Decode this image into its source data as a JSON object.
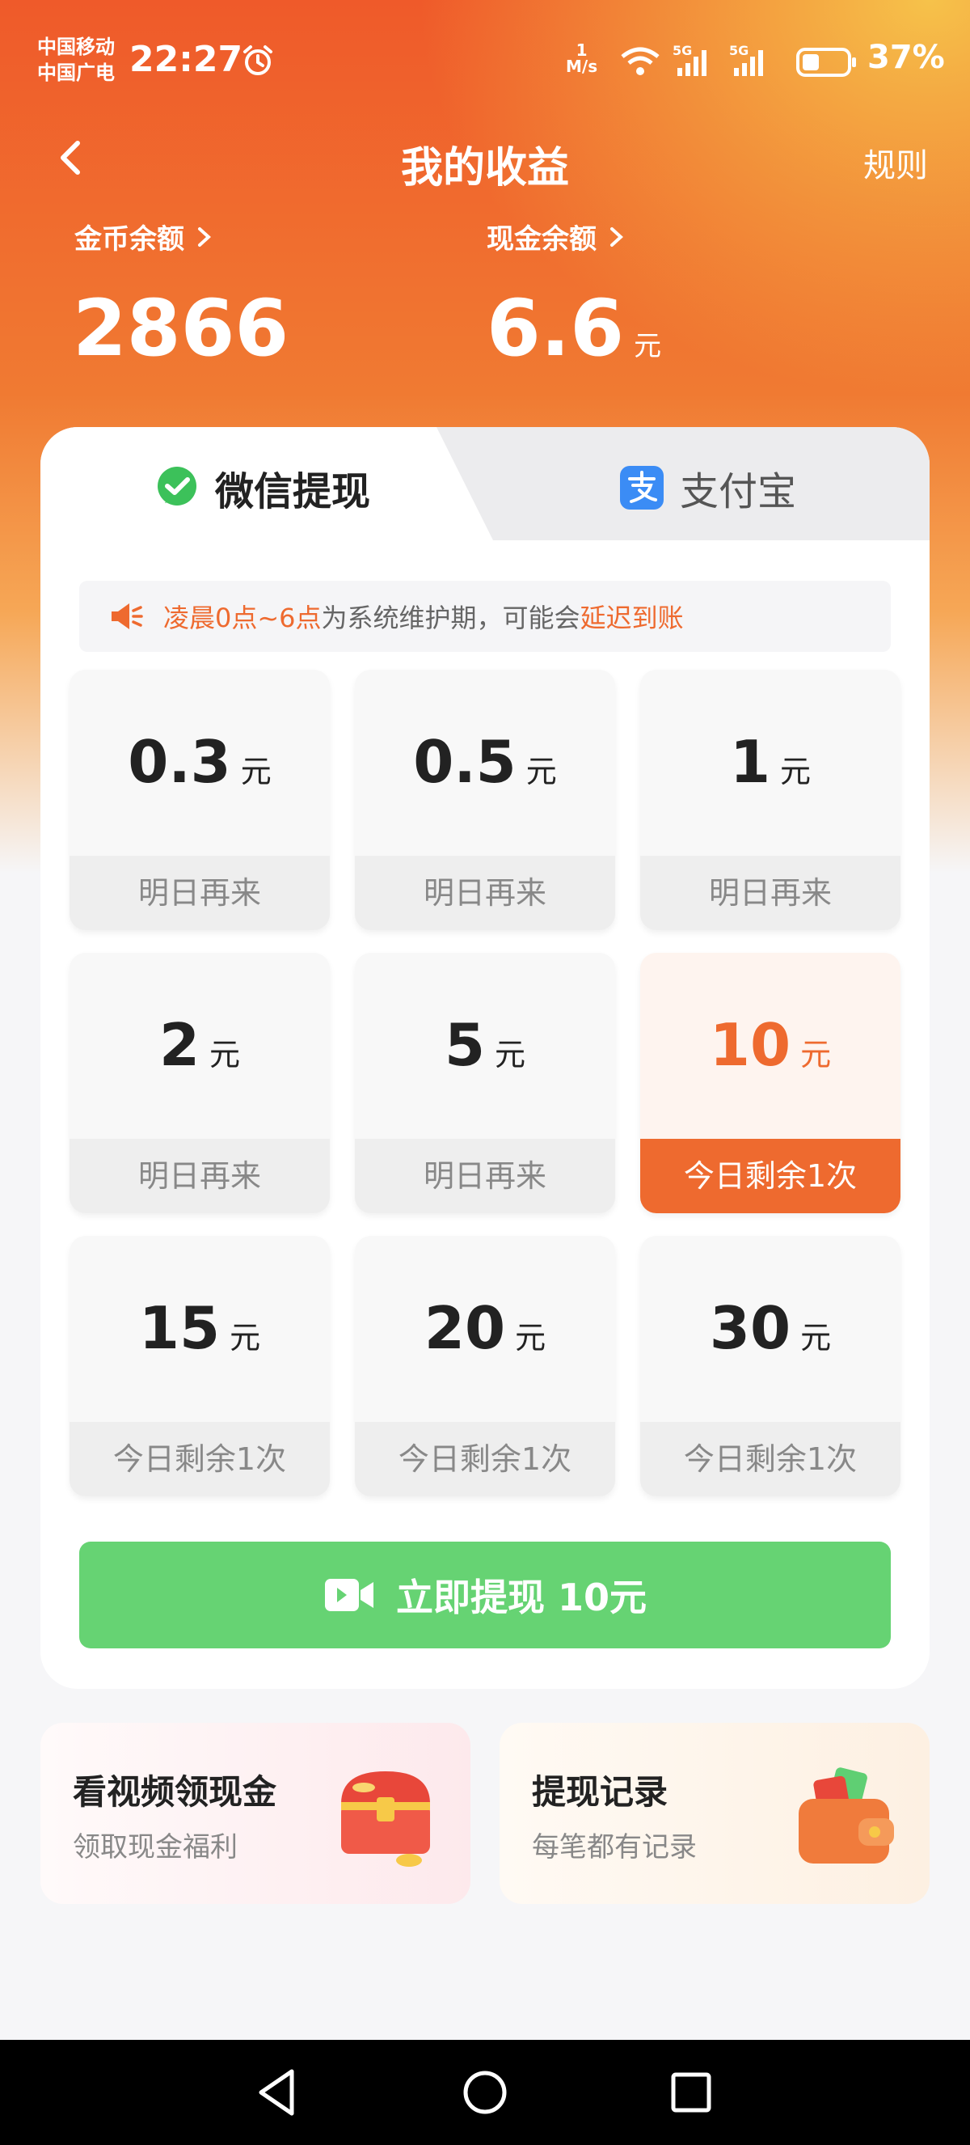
{
  "status_bar": {
    "carrier_1": "中国移动",
    "carrier_2": "中国广电",
    "time": "22:27",
    "net_speed_value": "1",
    "net_speed_unit": "M/s",
    "battery": "37%"
  },
  "header": {
    "title": "我的收益",
    "rules": "规则"
  },
  "balances": {
    "coin_label": "金币余额",
    "coin_value": "2866",
    "cash_label": "现金余额",
    "cash_value": "6.6",
    "cash_unit": "元"
  },
  "tabs": [
    {
      "label": "微信提现",
      "active": true
    },
    {
      "label": "支付宝",
      "active": false
    }
  ],
  "notice": {
    "part1": "凌晨0点~6点",
    "part2": "为系统维护期，可能会",
    "part3": "延迟到账"
  },
  "amounts": [
    {
      "value": "0.3",
      "unit": "元",
      "status": "明日再来",
      "selected": false
    },
    {
      "value": "0.5",
      "unit": "元",
      "status": "明日再来",
      "selected": false
    },
    {
      "value": "1",
      "unit": "元",
      "status": "明日再来",
      "selected": false
    },
    {
      "value": "2",
      "unit": "元",
      "status": "明日再来",
      "selected": false
    },
    {
      "value": "5",
      "unit": "元",
      "status": "明日再来",
      "selected": false
    },
    {
      "value": "10",
      "unit": "元",
      "status": "今日剩余1次",
      "selected": true
    },
    {
      "value": "15",
      "unit": "元",
      "status": "今日剩余1次",
      "selected": false
    },
    {
      "value": "20",
      "unit": "元",
      "status": "今日剩余1次",
      "selected": false
    },
    {
      "value": "30",
      "unit": "元",
      "status": "今日剩余1次",
      "selected": false
    }
  ],
  "withdraw_button": "立即提现 10元",
  "promos": [
    {
      "title": "看视频领现金",
      "subtitle": "领取现金福利"
    },
    {
      "title": "提现记录",
      "subtitle": "每笔都有记录"
    }
  ],
  "colors": {
    "accent": "#ee6a2f",
    "button_green": "#66d373",
    "wechat_green": "#3cc15a",
    "alipay_blue": "#3b8cf5"
  }
}
